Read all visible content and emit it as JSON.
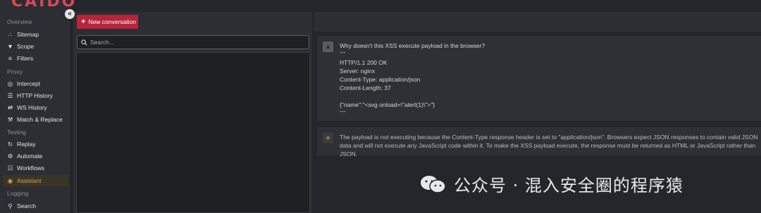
{
  "app": {
    "logo": "CAIDO"
  },
  "sidebar": {
    "collapse_icon": "«",
    "sections": {
      "overview": "Overview",
      "proxy": "Proxy",
      "testing": "Testing",
      "logging": "Logging"
    },
    "items": {
      "sitemap": "Sitemap",
      "scope": "Scope",
      "filters": "Filters",
      "intercept": "Intercept",
      "http_history": "HTTP History",
      "ws_history": "WS History",
      "match_replace": "Match & Replace",
      "replay": "Replay",
      "automate": "Automate",
      "workflows": "Workflows",
      "assistant": "Assistant",
      "search": "Search"
    },
    "active": "Assistant",
    "accent_color": "#e0a24a"
  },
  "conversations": {
    "new_button_label": "New conversation",
    "new_button_color": "#b8243c",
    "search_placeholder": "Search..."
  },
  "chat": {
    "user_message": {
      "lines": [
        "Why doesn't this XSS execute payload in the browser?",
        "---",
        "HTTP/1.1 200 OK",
        "Server: nginx",
        "Content-Type: application/json",
        "Content-Length: 37",
        "{\"name\":\"<svg onload=\\\"alert(1)\\\">\"}",
        "---"
      ]
    },
    "assistant_message": {
      "text": "The payload is not executing because the Content-Type response header is set to \"application/json\". Browsers expect JSON responses to contain valid JSON data and will not execute any JavaScript code within it. To make the XSS payload execute, the response must be returned as HTML or JavaScript rather than JSON."
    }
  },
  "watermark": {
    "text": "公众号 · 混入安全圈的程序猿"
  }
}
